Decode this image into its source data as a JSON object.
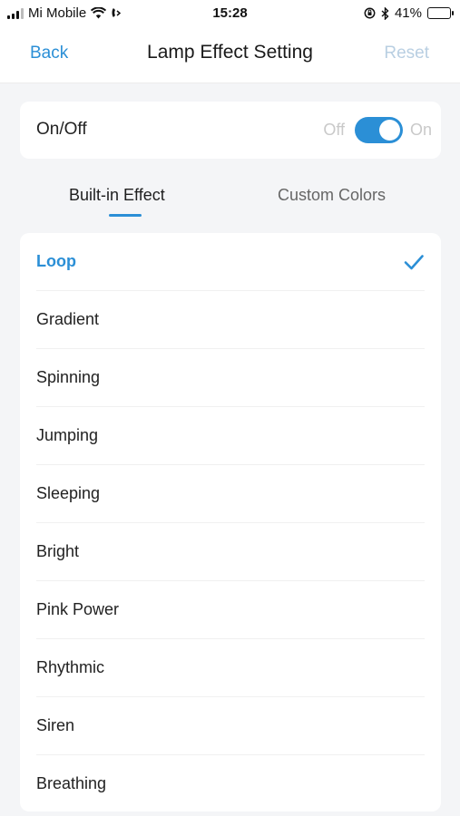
{
  "status_bar": {
    "carrier": "Mi Mobile",
    "time": "15:28",
    "battery_percent": "41%",
    "battery_level": 0.41
  },
  "nav": {
    "back_label": "Back",
    "title": "Lamp Effect Setting",
    "reset_label": "Reset"
  },
  "power": {
    "label": "On/Off",
    "off_label": "Off",
    "on_label": "On",
    "is_on": true
  },
  "tabs": [
    {
      "label": "Built-in Effect",
      "active": true
    },
    {
      "label": "Custom Colors",
      "active": false
    }
  ],
  "effects": [
    {
      "label": "Loop",
      "selected": true
    },
    {
      "label": "Gradient",
      "selected": false
    },
    {
      "label": "Spinning",
      "selected": false
    },
    {
      "label": "Jumping",
      "selected": false
    },
    {
      "label": "Sleeping",
      "selected": false
    },
    {
      "label": "Bright",
      "selected": false
    },
    {
      "label": "Pink Power",
      "selected": false
    },
    {
      "label": "Rhythmic",
      "selected": false
    },
    {
      "label": "Siren",
      "selected": false
    },
    {
      "label": "Breathing",
      "selected": false
    }
  ],
  "colors": {
    "accent": "#2b8fd6",
    "reset_disabled": "#b9cfe2",
    "background": "#f4f5f7"
  }
}
